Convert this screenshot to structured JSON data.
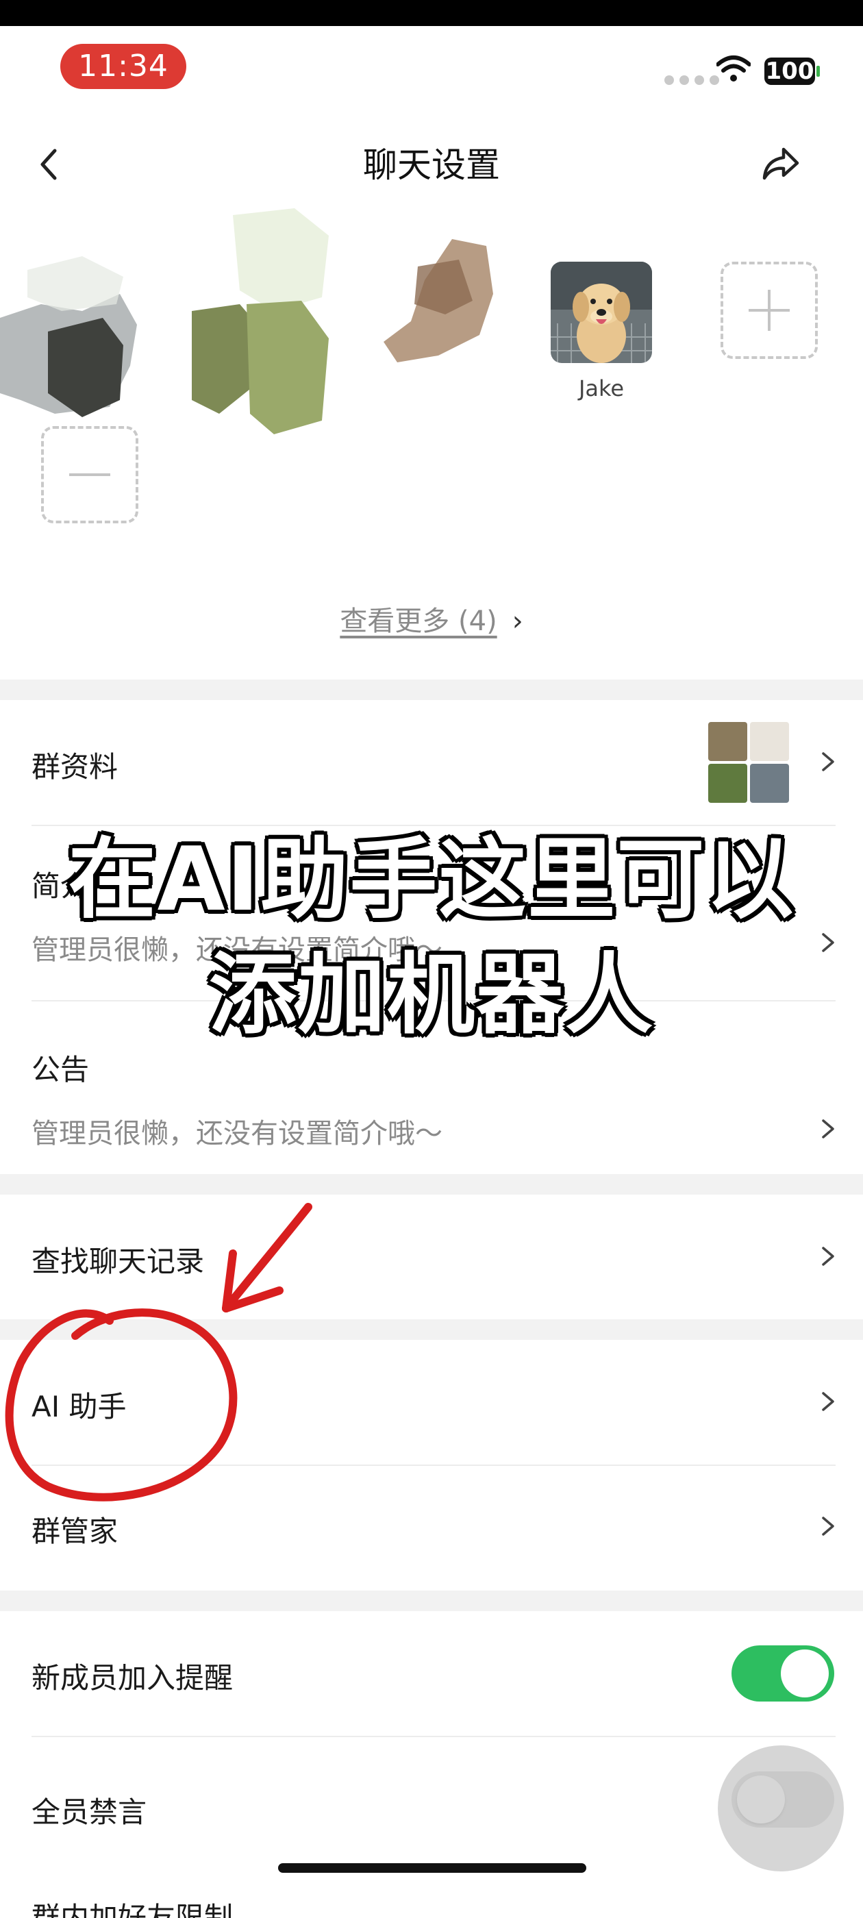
{
  "status": {
    "time": "11:34",
    "battery": "100"
  },
  "nav": {
    "title": "聊天设置"
  },
  "members": {
    "jake_name": "Jake",
    "see_more": "查看更多 (4)"
  },
  "group_info": {
    "label": "群资料"
  },
  "intro": {
    "label": "简介",
    "value": "管理员很懒，还没有设置简介哦～"
  },
  "notice": {
    "label": "公告",
    "value": "管理员很懒，还没有设置简介哦～"
  },
  "search_history": {
    "label": "查找聊天记录"
  },
  "ai_assistant": {
    "label": "AI 助手"
  },
  "group_butler": {
    "label": "群管家"
  },
  "new_member_alert": {
    "label": "新成员加入提醒",
    "enabled": true
  },
  "mute_all": {
    "label": "全员禁言",
    "enabled": false
  },
  "partial_bottom": {
    "label": "群内加好友限制"
  },
  "overlay": {
    "line1": "在AI助手这里可以",
    "line2": "添加机器人"
  },
  "colors": {
    "accent_green": "#2dbe60",
    "annotation_red": "#d81e1e",
    "time_pill": "#dd3a33"
  }
}
